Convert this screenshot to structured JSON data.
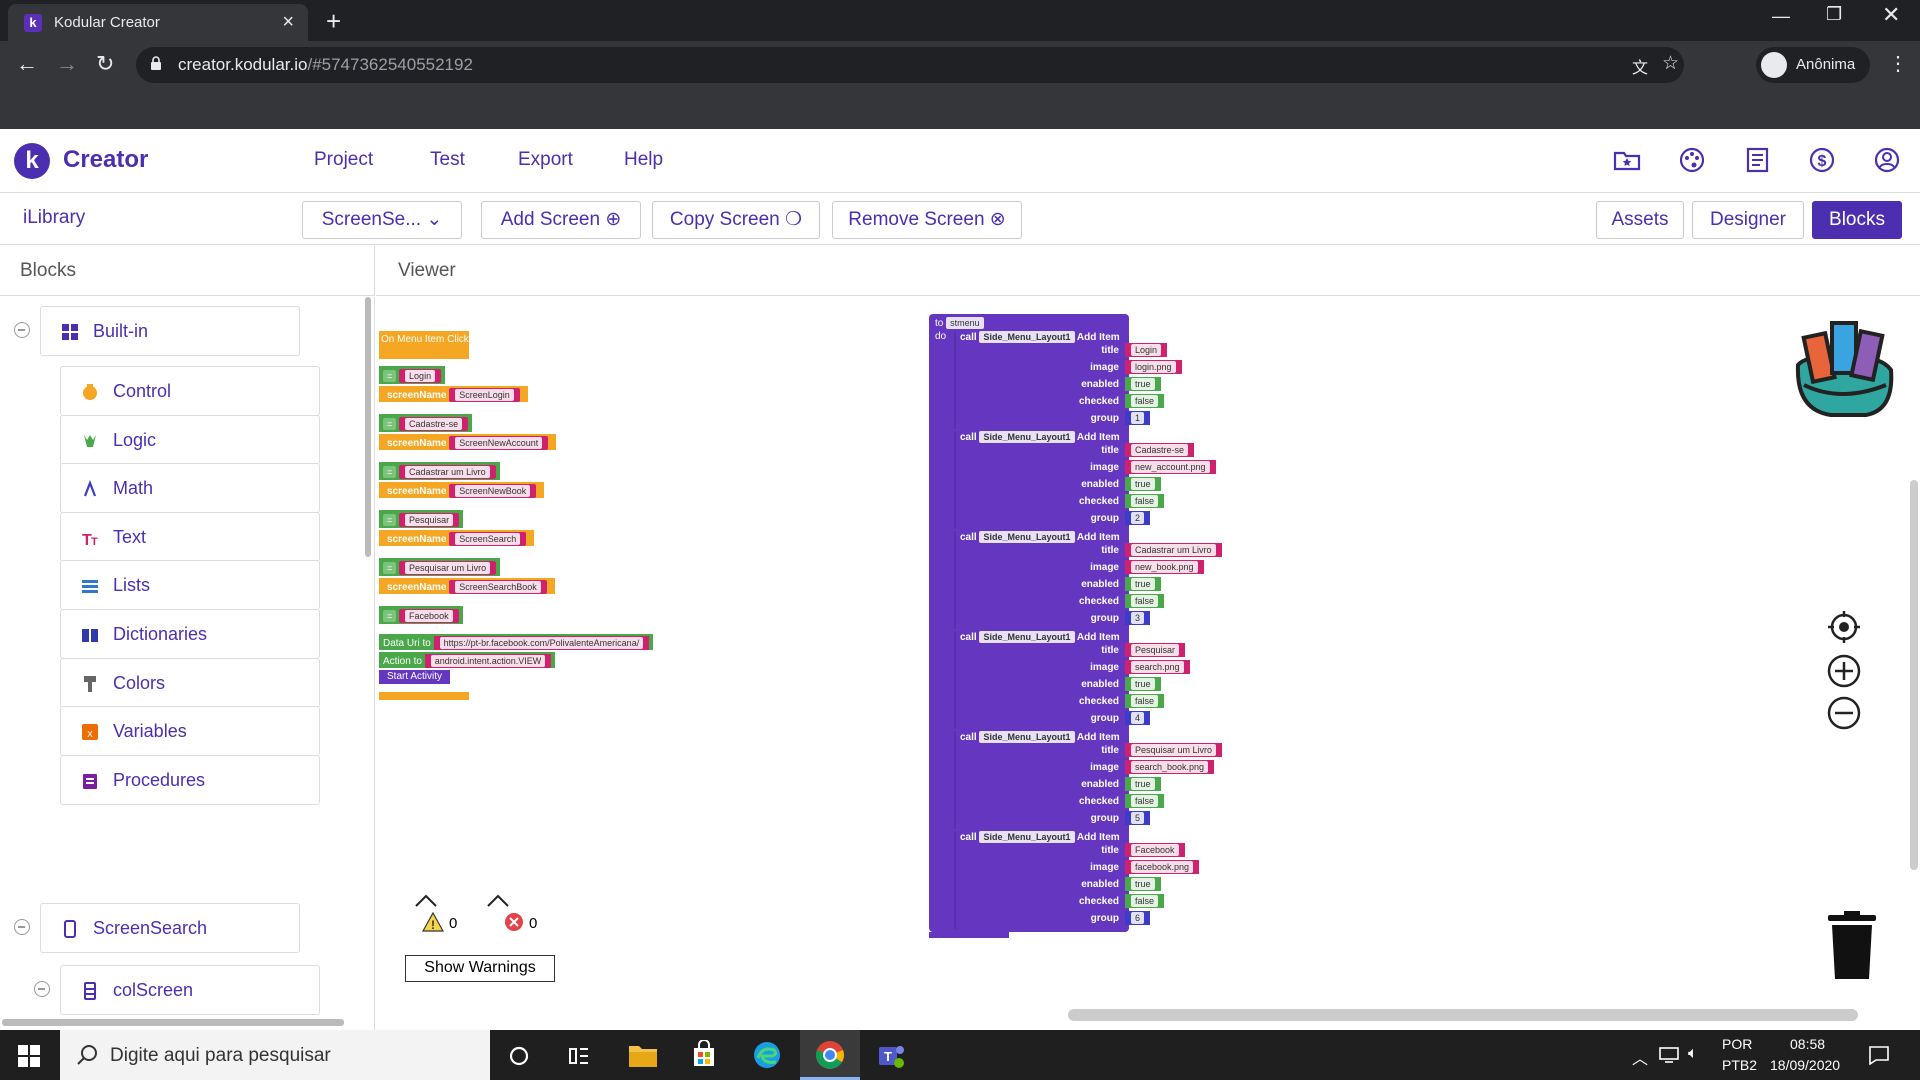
{
  "browser": {
    "tab_title": "Kodular Creator",
    "url_host": "creator.kodular.io",
    "url_rest": "/#5747362540552192",
    "profile": "Anônima"
  },
  "header": {
    "brand": "Creator",
    "menus": [
      "Project",
      "Test",
      "Export",
      "Help"
    ],
    "icons": [
      "folder-star-icon",
      "palette-icon",
      "news-icon",
      "dollar-icon",
      "account-icon"
    ]
  },
  "toolbar": {
    "project_name": "iLibrary",
    "screen_select": "ScreenSe...",
    "add_screen": "Add Screen",
    "copy_screen": "Copy Screen",
    "remove_screen": "Remove Screen",
    "assets": "Assets",
    "designer": "Designer",
    "blocks": "Blocks"
  },
  "panels": {
    "blocks_title": "Blocks",
    "viewer_title": "Viewer"
  },
  "blocks_tree": {
    "builtin": "Built-in",
    "items": [
      {
        "label": "Control",
        "color": "#f5a623",
        "icon": "control-icon"
      },
      {
        "label": "Logic",
        "color": "#4aa84a",
        "icon": "logic-icon"
      },
      {
        "label": "Math",
        "color": "#3d3cc8",
        "icon": "math-icon"
      },
      {
        "label": "Text",
        "color": "#d0216f",
        "icon": "text-icon"
      },
      {
        "label": "Lists",
        "color": "#3178c6",
        "icon": "lists-icon"
      },
      {
        "label": "Dictionaries",
        "color": "#2d3aa8",
        "icon": "dictionaries-icon"
      },
      {
        "label": "Colors",
        "color": "#666666",
        "icon": "colors-icon"
      },
      {
        "label": "Variables",
        "color": "#ef6c00",
        "icon": "variables-icon"
      },
      {
        "label": "Procedures",
        "color": "#7b1fa2",
        "icon": "procedures-icon"
      }
    ],
    "screen": "ScreenSearch",
    "component": "colScreen"
  },
  "event_block": {
    "header": "On Menu Item Click",
    "rows": [
      {
        "kind": "cmp",
        "text": "Login"
      },
      {
        "kind": "name",
        "label": "screenName",
        "text": "ScreenLogin"
      },
      {
        "kind": "cmp",
        "text": "Cadastre-se"
      },
      {
        "kind": "name",
        "label": "screenName",
        "text": "ScreenNewAccount"
      },
      {
        "kind": "cmp",
        "text": "Cadastrar um Livro"
      },
      {
        "kind": "name",
        "label": "screenName",
        "text": "ScreenNewBook"
      },
      {
        "kind": "cmp",
        "text": "Pesquisar"
      },
      {
        "kind": "name",
        "label": "screenName",
        "text": "ScreenSearch"
      },
      {
        "kind": "cmp",
        "text": "Pesquisar um Livro"
      },
      {
        "kind": "name",
        "label": "screenName",
        "text": "ScreenSearchBook"
      },
      {
        "kind": "cmp",
        "text": "Facebook"
      }
    ],
    "data_uri_label": "Data Uri",
    "data_uri_to": "to",
    "data_uri": "https://pt-br.facebook.com/PolivalenteAmericana/",
    "action_label": "Action",
    "action_to": "to",
    "action": "android.intent.action.VIEW",
    "start_activity": "Start Activity"
  },
  "proc_block": {
    "to_label": "to",
    "name": "stmenu",
    "do_label": "do",
    "call_label": "call",
    "component": "Side_Menu_Layout1",
    "method": "Add Item",
    "field_labels": [
      "title",
      "image",
      "enabled",
      "checked",
      "group"
    ],
    "items": [
      {
        "title": "Login",
        "image": "login.png",
        "enabled": "true",
        "checked": "false",
        "group": "1"
      },
      {
        "title": "Cadastre-se",
        "image": "new_account.png",
        "enabled": "true",
        "checked": "false",
        "group": "2"
      },
      {
        "title": "Cadastrar um Livro",
        "image": "new_book.png",
        "enabled": "true",
        "checked": "false",
        "group": "3"
      },
      {
        "title": "Pesquisar",
        "image": "search.png",
        "enabled": "true",
        "checked": "false",
        "group": "4"
      },
      {
        "title": "Pesquisar um Livro",
        "image": "search_book.png",
        "enabled": "true",
        "checked": "false",
        "group": "5"
      },
      {
        "title": "Facebook",
        "image": "facebook.png",
        "enabled": "true",
        "checked": "false",
        "group": "6"
      }
    ]
  },
  "warnings": {
    "warning_count": "0",
    "error_count": "0",
    "show_label": "Show Warnings"
  },
  "taskbar": {
    "search_placeholder": "Digite aqui para pesquisar",
    "lang": "POR",
    "layout": "PTB2",
    "time": "08:58",
    "date": "18/09/2020"
  }
}
